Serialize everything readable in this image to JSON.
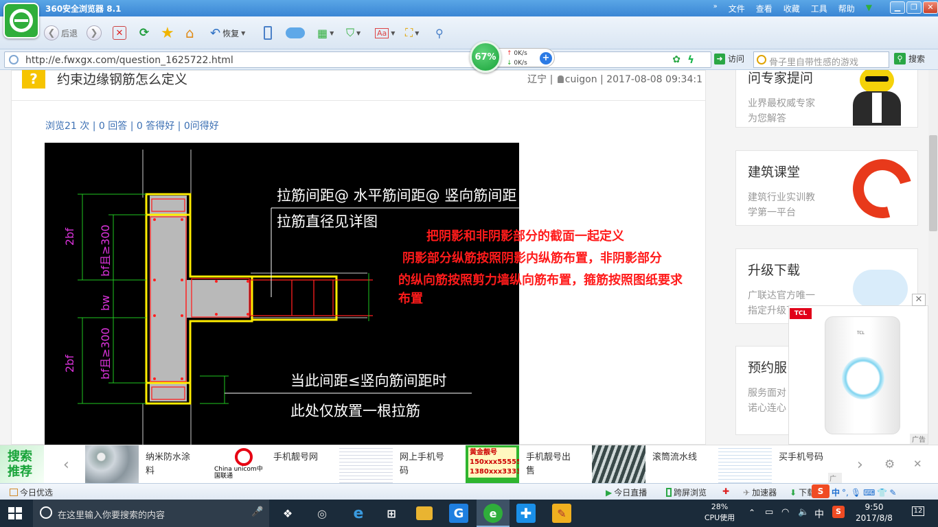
{
  "browser": {
    "title": "360安全浏览器 8.1",
    "menu": [
      "文件",
      "查看",
      "收藏",
      "工具",
      "帮助"
    ],
    "toolbar": {
      "back": "后退",
      "restore": "恢复"
    },
    "url": "http://e.fwxgx.com/question_1625722.html",
    "visit_label": "访问",
    "search_placeholder": "骨子里自带性感的游戏",
    "search_label": "搜索",
    "speed": {
      "percent": "67%",
      "up": "0K/s",
      "down": "0K/s"
    }
  },
  "question": {
    "title": "约束边缘钢筋怎么定义",
    "location": "辽宁",
    "user": "cuigon",
    "time": "2017-08-08 09:34:1",
    "stats": "浏览21 次 | 0 回答 | 0 答得好 | 0问得好"
  },
  "drawing": {
    "annotation_1": "拉筋间距@ 水平筋间距@ 竖向筋间距",
    "annotation_2": "拉筋直径见详图",
    "annotation_3": "当此间距≤竖向筋间距时",
    "annotation_4": "此处仅放置一根拉筋",
    "dim_1": "2bf",
    "dim_2": "bf且≥300",
    "dim_3": "bw",
    "dim_4": "bf且≥300",
    "dim_5": "2bf"
  },
  "overlay_text": {
    "line_1": "把阴影和非阴影部分的截面一起定义",
    "line_2": "阴影部分纵筋按照阴影内纵筋布置，非阴影部分",
    "line_3": "的纵向筋按照剪力墙纵向筋布置，箍筋按照图纸要求",
    "line_4": "布置"
  },
  "sidebar": [
    {
      "title": "问专家提问",
      "line1": "业界最权威专家",
      "line2": "为您解答"
    },
    {
      "title": "建筑课堂",
      "line1": "建筑行业实训教",
      "line2": "学第一平台"
    },
    {
      "title": "升级下载",
      "line1": "广联达官方唯一",
      "line2": "指定升级下载"
    },
    {
      "title": "预约服",
      "line1": "服务面对",
      "line2": "诺心连心"
    }
  ],
  "ad": {
    "brand": "TCL",
    "label": "广告"
  },
  "recommend": {
    "head": "搜索推荐",
    "items": [
      {
        "text": "纳米防水涂料"
      },
      {
        "text": "手机靓号网",
        "thumb_text": "China unicom中国联通"
      },
      {
        "text": "网上手机号码"
      },
      {
        "text": "手机靓号出售",
        "thumb_text": "黄金靓号 150xxx55555 1380xxx3333"
      },
      {
        "text": "滚筒流水线"
      },
      {
        "text": "买手机号码"
      }
    ],
    "ad_label": "广告"
  },
  "statusbar": {
    "today_pick": "今日优选",
    "live": "今日直播",
    "cross_screen": "跨屏浏览",
    "accelerator": "加速器",
    "download": "下载",
    "ime": "中"
  },
  "taskbar": {
    "search_placeholder": "在这里输入你要搜索的内容",
    "cpu": "28%",
    "cpu_label": "CPU使用",
    "lang": "中",
    "time": "9:50",
    "date": "2017/8/8",
    "notifications": "12"
  },
  "colors": {
    "accent_green": "#18a339",
    "overlay_red": "#ff1b1b",
    "cad_yellow": "#ffee00"
  }
}
